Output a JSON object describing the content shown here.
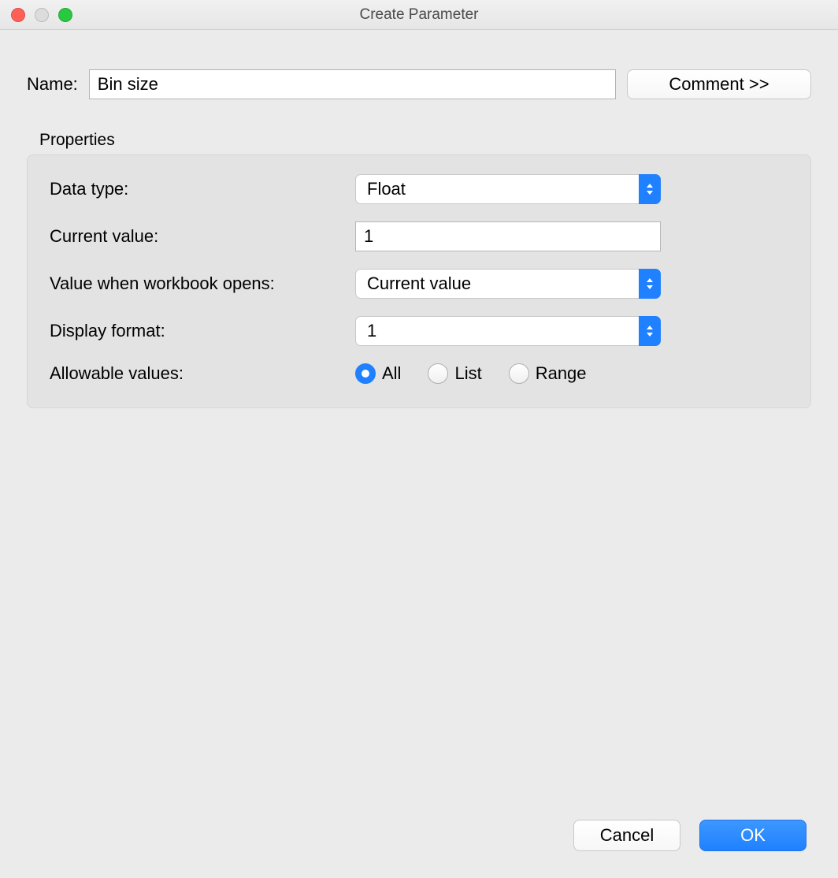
{
  "window": {
    "title": "Create Parameter"
  },
  "name": {
    "label": "Name:",
    "value": "Bin size"
  },
  "comment_button": "Comment >>",
  "properties": {
    "section_label": "Properties",
    "data_type": {
      "label": "Data type:",
      "value": "Float"
    },
    "current_value": {
      "label": "Current value:",
      "value": "1"
    },
    "value_when_open": {
      "label": "Value when workbook opens:",
      "value": "Current value"
    },
    "display_format": {
      "label": "Display format:",
      "value": "1"
    },
    "allowable_values": {
      "label": "Allowable values:",
      "options": {
        "all": "All",
        "list": "List",
        "range": "Range"
      },
      "selected": "all"
    }
  },
  "footer": {
    "cancel": "Cancel",
    "ok": "OK"
  }
}
